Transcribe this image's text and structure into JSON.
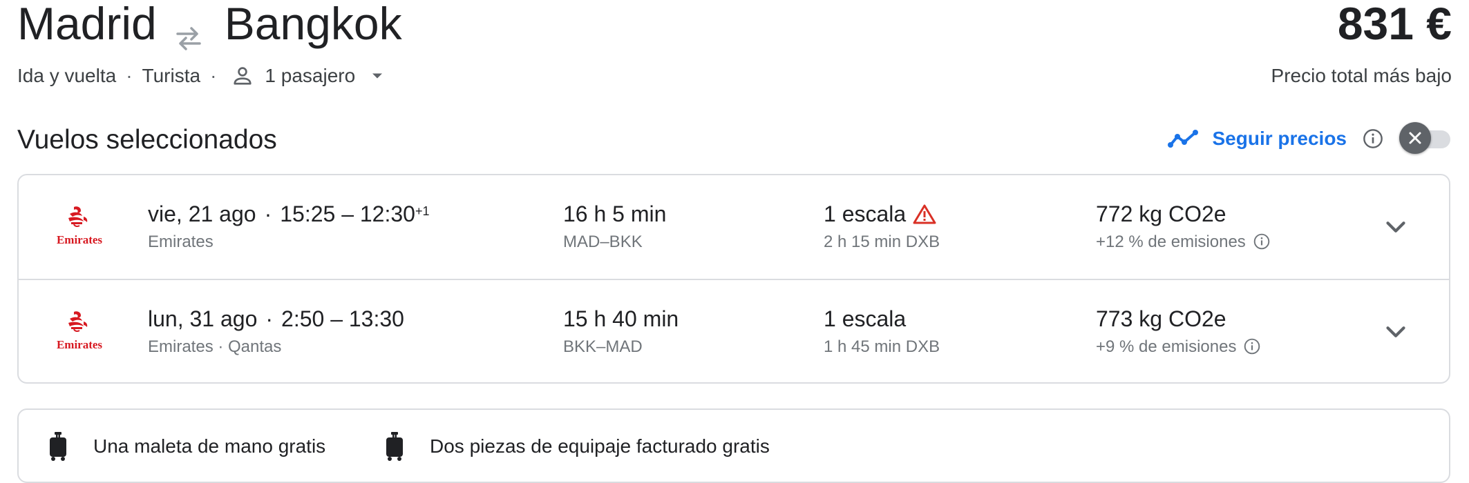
{
  "header": {
    "origin": "Madrid",
    "destination": "Bangkok",
    "swap_icon": "swap-arrows-icon",
    "price": "831 €",
    "price_label": "Precio total más bajo",
    "trip_type": "Ida y vuelta",
    "cabin": "Turista",
    "separator": "·",
    "passengers": "1 pasajero"
  },
  "section": {
    "title": "Vuelos seleccionados",
    "track_label": "Seguir precios",
    "track_enabled": false
  },
  "flights": [
    {
      "airline_logo": "Emirates",
      "date": "vie, 21 ago",
      "times": "15:25 – 12:30",
      "day_offset": "+1",
      "airlines": "Emirates",
      "duration": "16 h 5 min",
      "route": "MAD–BKK",
      "stops": "1 escala",
      "layover": "2 h 15 min DXB",
      "has_warning": true,
      "emissions": "772 kg CO2e",
      "emissions_delta": "+12 % de emisiones"
    },
    {
      "airline_logo": "Emirates",
      "date": "lun, 31 ago",
      "times": "2:50 – 13:30",
      "day_offset": "",
      "airlines": "Emirates · Qantas",
      "duration": "15 h 40 min",
      "route": "BKK–MAD",
      "stops": "1 escala",
      "layover": "1 h 45 min DXB",
      "has_warning": false,
      "emissions": "773 kg CO2e",
      "emissions_delta": "+9 % de emisiones"
    }
  ],
  "baggage": {
    "carry_on": "Una maleta de mano gratis",
    "checked": "Dos piezas de equipaje facturado gratis"
  },
  "colors": {
    "accent": "#1a73e8",
    "text": "#202124",
    "secondary": "#70757a",
    "warning": "#d93025",
    "emirates_red": "#d71921",
    "border": "#dadce0"
  }
}
